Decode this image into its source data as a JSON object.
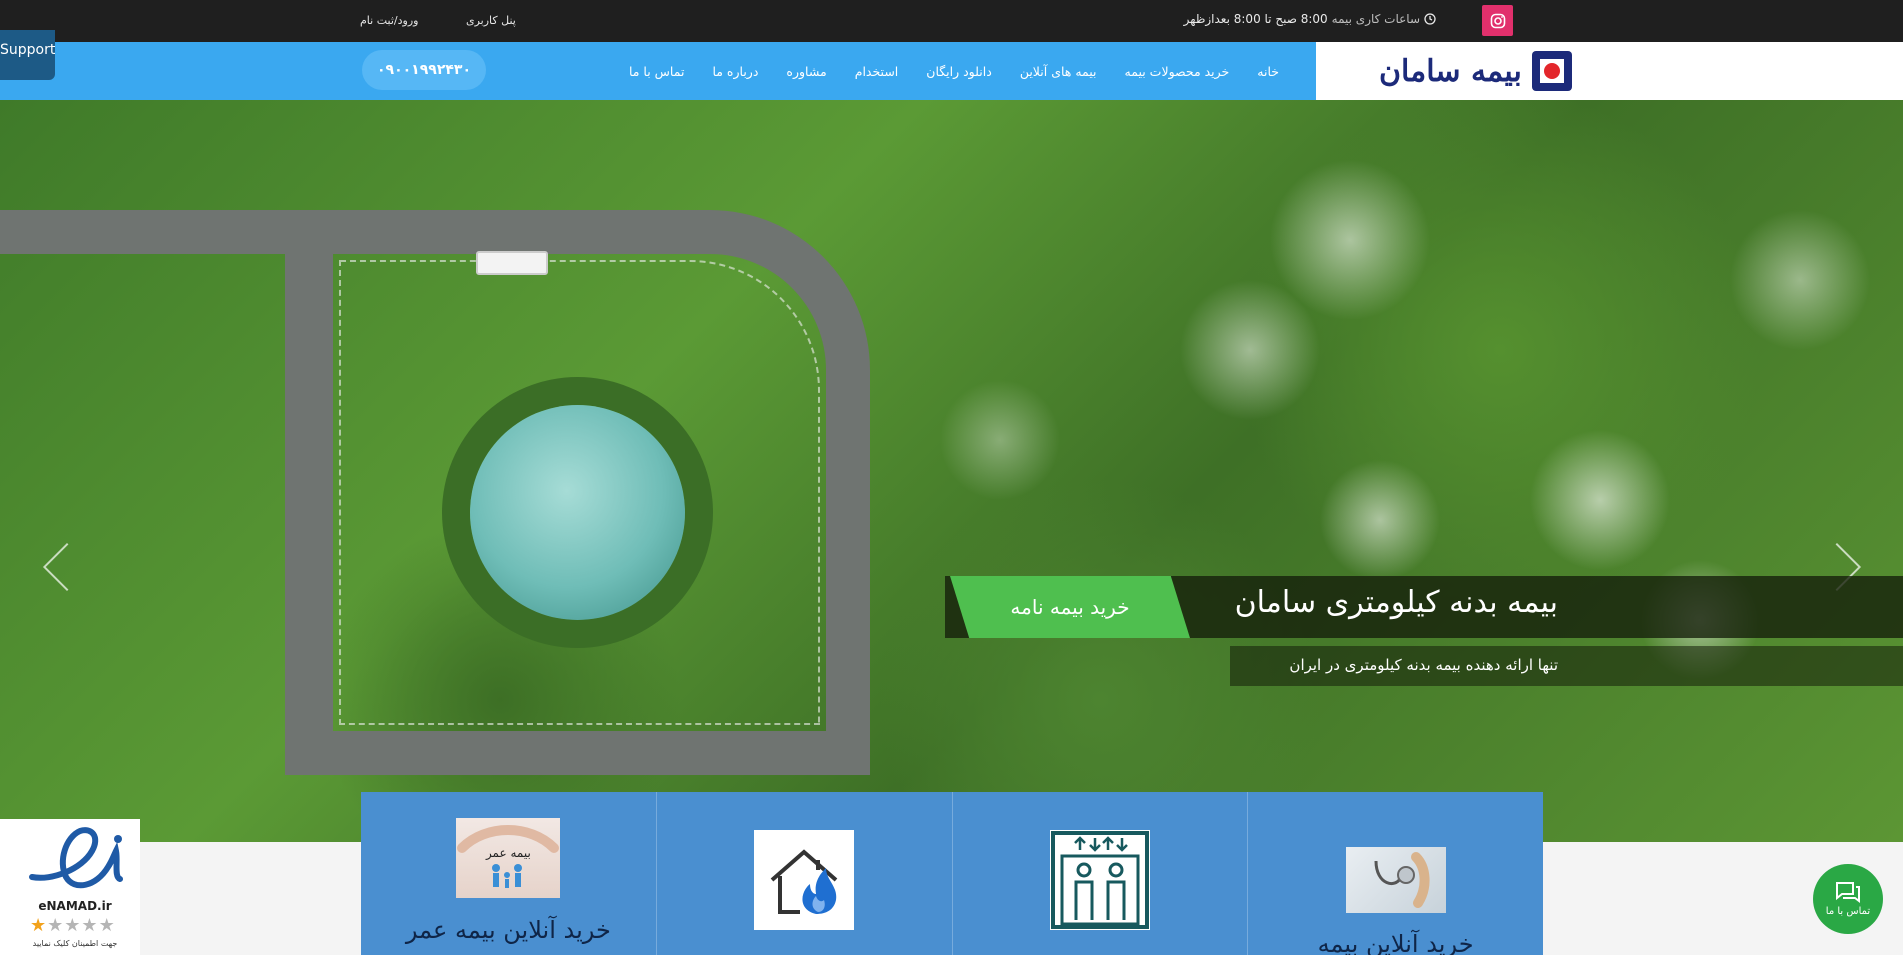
{
  "topbar": {
    "hours_prefix": "ساعات کاری بیمه",
    "hours_value": "8:00 صبح تا 8:00 بعدازظهر",
    "user_panel": "پنل کاربری",
    "login": "ورود/ثبت نام"
  },
  "support": {
    "label": "Support"
  },
  "logo": {
    "text": "بیمه سامان"
  },
  "nav": {
    "items": [
      "خانه",
      "خرید محصولات بیمه",
      "بیمه های آنلاین",
      "دانلود رایگان",
      "استخدام",
      "مشاوره",
      "درباره ما",
      "تماس با ما"
    ],
    "phone": "۰۹۰۰۱۹۹۲۴۳۰"
  },
  "hero": {
    "title": "بیمه بدنه کیلومتری سامان",
    "buy_button": "خرید بیمه نامه",
    "subtitle": "تنها ارائه دهنده بیمه بدنه کیلومتری در ایران"
  },
  "cards": [
    {
      "title": "خرید آنلاین بیمه",
      "image_label": ""
    },
    {
      "title": "",
      "image_label": ""
    },
    {
      "title": "",
      "image_label": ""
    },
    {
      "title": "خرید آنلاین بیمه عمر",
      "image_label": "بیمه عمر"
    }
  ],
  "enamad": {
    "label": "eNAMAD.ir",
    "note": "جهت اطمینان کلیک نمایید",
    "stars_on": 1,
    "stars_total": 5
  },
  "contact_fab": {
    "label": "تماس با ما"
  },
  "colors": {
    "topbar": "#1f1f1f",
    "nav": "#3aa8f0",
    "cards": "#4a8fd0",
    "buy": "#4fbf4f",
    "fab": "#2aa845",
    "logo": "#1c2a7a"
  }
}
